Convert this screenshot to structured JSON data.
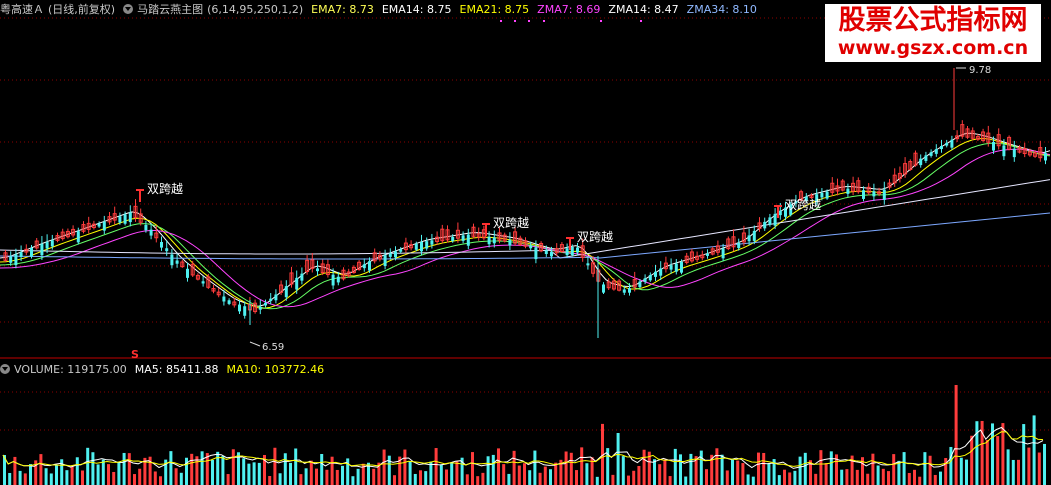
{
  "main_header": {
    "stock": "粤高速Ａ",
    "period": "(日线,前复权)",
    "indicator": "马踏云燕主图",
    "params": "(6,14,95,250,1,2)",
    "lines": [
      {
        "label": "EMA7:",
        "value": "8.73",
        "color": "#ffff55"
      },
      {
        "label": "EMA14:",
        "value": "8.75",
        "color": "#ffffff"
      },
      {
        "label": "EMA21:",
        "value": "8.75",
        "color": "#ffff00"
      },
      {
        "label": "ZMA7:",
        "value": "8.69",
        "color": "#ff44ff"
      },
      {
        "label": "ZMA14:",
        "value": "8.47",
        "color": "#ffffff"
      },
      {
        "label": "ZMA34:",
        "value": "8.10",
        "color": "#8fb8ff"
      }
    ]
  },
  "volume_header": {
    "lines": [
      {
        "label": "VOLUME:",
        "value": "119175.00",
        "color": "#c8c8c8"
      },
      {
        "label": "MA5:",
        "value": "85411.88",
        "color": "#ffffff"
      },
      {
        "label": "MA10:",
        "value": "103772.46",
        "color": "#ffff00"
      }
    ]
  },
  "watermark": {
    "line1": "股票公式指标网",
    "line2": "www.gszx.com.cn"
  },
  "signal_label": "双跨越",
  "high_label": "9.78",
  "low_label": "6.59",
  "s_marker": "S",
  "colors": {
    "up": "#ff3c3c",
    "down": "#4ff0f0",
    "grid": "#8b0000",
    "ema": "#ffffff"
  }
}
